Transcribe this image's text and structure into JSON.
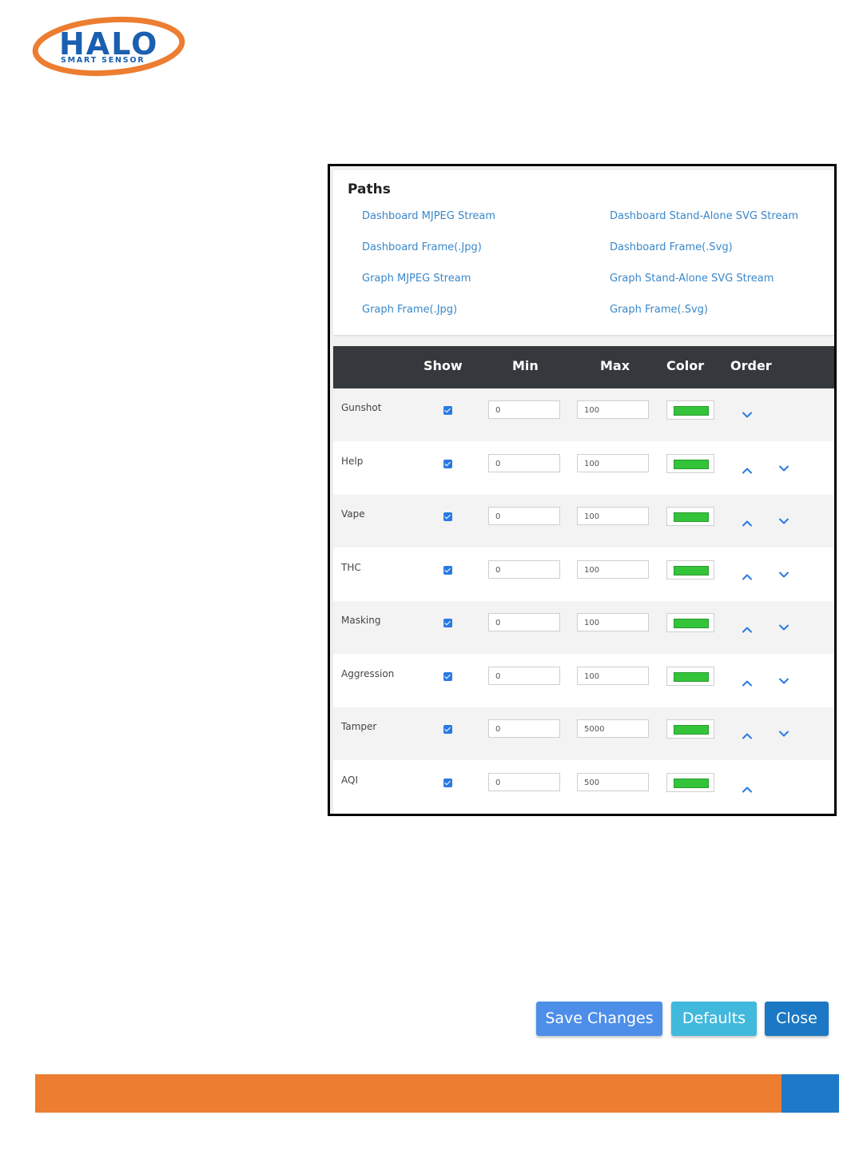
{
  "logo": {
    "brand": "HALO",
    "tagline": "SMART SENSOR",
    "colors": {
      "orange": "#ec7d31",
      "blue": "#1a5fb0"
    }
  },
  "paths": {
    "title": "Paths",
    "links": [
      "Dashboard MJPEG Stream",
      "Dashboard Stand-Alone SVG Stream",
      "Dashboard Frame(.Jpg)",
      "Dashboard Frame(.Svg)",
      "Graph MJPEG Stream",
      "Graph Stand-Alone SVG Stream",
      "Graph Frame(.Jpg)",
      "Graph Frame(.Svg)"
    ]
  },
  "grid": {
    "headers": {
      "show": "Show",
      "min": "Min",
      "max": "Max",
      "color": "Color",
      "order": "Order"
    },
    "rows": [
      {
        "name": "Gunshot",
        "show": true,
        "min": "0",
        "max": "100",
        "color": "#33c43a",
        "up": false,
        "down": true
      },
      {
        "name": "Help",
        "show": true,
        "min": "0",
        "max": "100",
        "color": "#33c43a",
        "up": true,
        "down": true
      },
      {
        "name": "Vape",
        "show": true,
        "min": "0",
        "max": "100",
        "color": "#33c43a",
        "up": true,
        "down": true
      },
      {
        "name": "THC",
        "show": true,
        "min": "0",
        "max": "100",
        "color": "#33c43a",
        "up": true,
        "down": true
      },
      {
        "name": "Masking",
        "show": true,
        "min": "0",
        "max": "100",
        "color": "#33c43a",
        "up": true,
        "down": true
      },
      {
        "name": "Aggression",
        "show": true,
        "min": "0",
        "max": "100",
        "color": "#33c43a",
        "up": true,
        "down": true
      },
      {
        "name": "Tamper",
        "show": true,
        "min": "0",
        "max": "5000",
        "color": "#33c43a",
        "up": true,
        "down": true
      },
      {
        "name": "AQI",
        "show": true,
        "min": "0",
        "max": "500",
        "color": "#33c43a",
        "up": true,
        "down": false
      }
    ]
  },
  "buttons": {
    "save": "Save Changes",
    "defaults": "Defaults",
    "close": "Close"
  },
  "colors": {
    "link": "#3a87c9",
    "header_bg": "#35383c",
    "checkbox": "#2a7ae2",
    "arrow": "#2a7ae2",
    "footer_orange": "#ec7d31",
    "footer_blue": "#1e7ac8"
  }
}
